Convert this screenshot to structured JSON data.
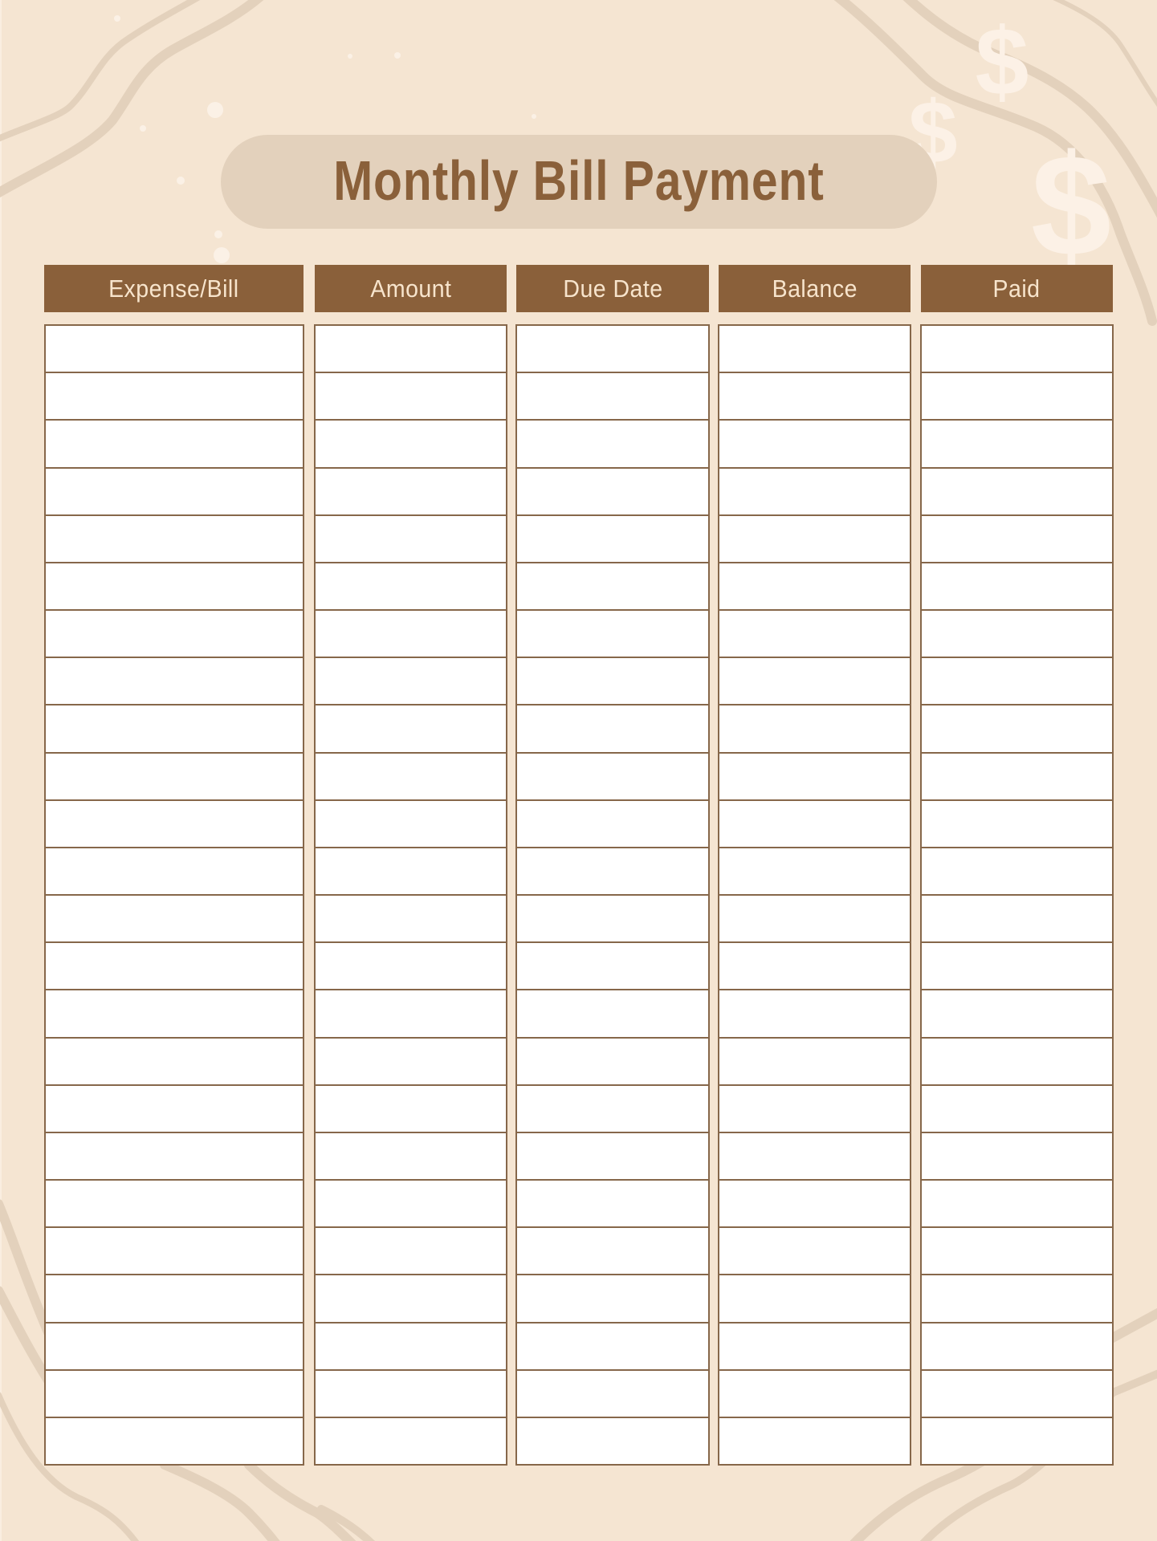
{
  "title": "Monthly Bill Payment",
  "colors": {
    "background": "#f5e5d2",
    "pill": "#e3d1bc",
    "accent_brown": "#8a603a",
    "header_text": "#f7e4cc",
    "grid_line": "#86674a",
    "decor_wave": "#e3d1bc",
    "decor_symbol": "#fcf1e6"
  },
  "decorations": {
    "symbols": [
      "dollar-sign",
      "dollar-sign",
      "dollar-sign"
    ],
    "symbol_char": "$"
  },
  "table": {
    "columns": [
      {
        "key": "expense",
        "label": "Expense/Bill"
      },
      {
        "key": "amount",
        "label": "Amount"
      },
      {
        "key": "due_date",
        "label": "Due Date"
      },
      {
        "key": "balance",
        "label": "Balance"
      },
      {
        "key": "paid",
        "label": "Paid"
      }
    ],
    "row_count": 24,
    "rows": [
      [
        "",
        "",
        "",
        "",
        ""
      ],
      [
        "",
        "",
        "",
        "",
        ""
      ],
      [
        "",
        "",
        "",
        "",
        ""
      ],
      [
        "",
        "",
        "",
        "",
        ""
      ],
      [
        "",
        "",
        "",
        "",
        ""
      ],
      [
        "",
        "",
        "",
        "",
        ""
      ],
      [
        "",
        "",
        "",
        "",
        ""
      ],
      [
        "",
        "",
        "",
        "",
        ""
      ],
      [
        "",
        "",
        "",
        "",
        ""
      ],
      [
        "",
        "",
        "",
        "",
        ""
      ],
      [
        "",
        "",
        "",
        "",
        ""
      ],
      [
        "",
        "",
        "",
        "",
        ""
      ],
      [
        "",
        "",
        "",
        "",
        ""
      ],
      [
        "",
        "",
        "",
        "",
        ""
      ],
      [
        "",
        "",
        "",
        "",
        ""
      ],
      [
        "",
        "",
        "",
        "",
        ""
      ],
      [
        "",
        "",
        "",
        "",
        ""
      ],
      [
        "",
        "",
        "",
        "",
        ""
      ],
      [
        "",
        "",
        "",
        "",
        ""
      ],
      [
        "",
        "",
        "",
        "",
        ""
      ],
      [
        "",
        "",
        "",
        "",
        ""
      ],
      [
        "",
        "",
        "",
        "",
        ""
      ],
      [
        "",
        "",
        "",
        "",
        ""
      ],
      [
        "",
        "",
        "",
        "",
        ""
      ]
    ]
  }
}
